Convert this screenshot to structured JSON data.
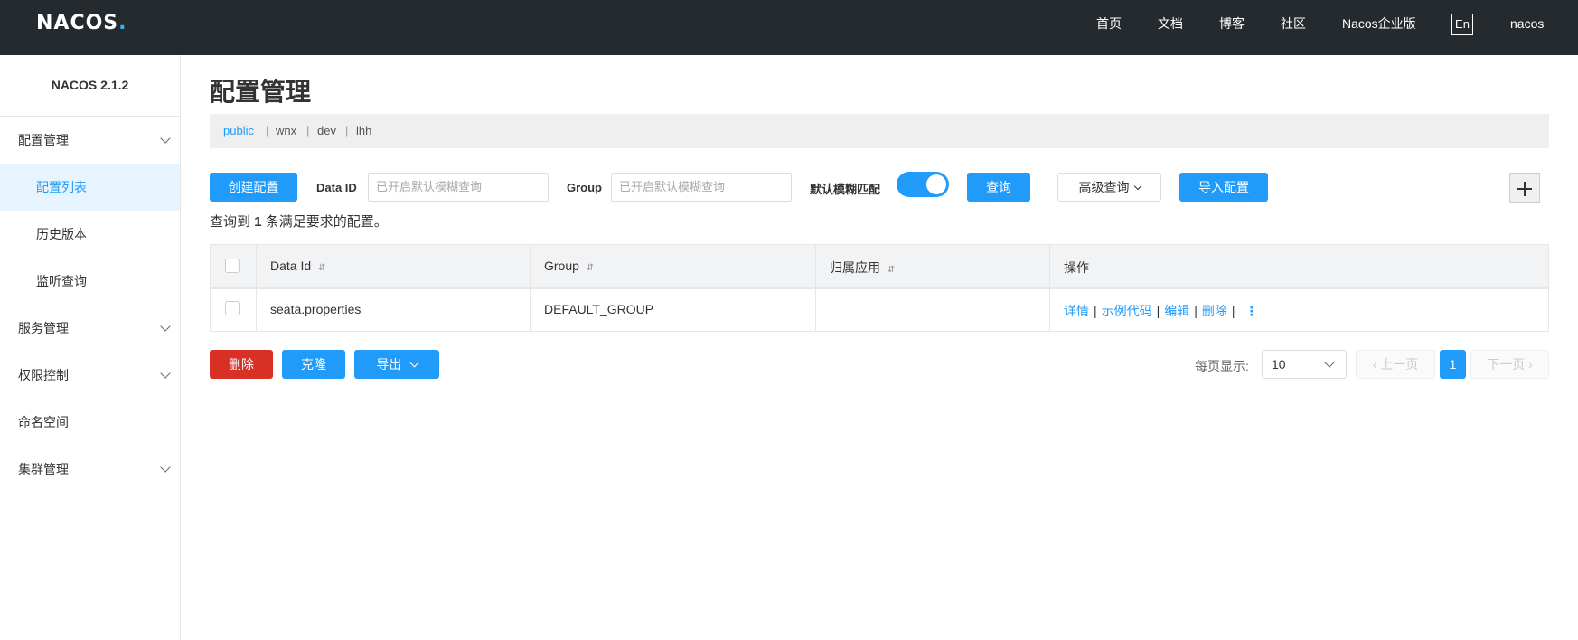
{
  "topbar": {
    "logo": "NACOS",
    "nav": [
      "首页",
      "文档",
      "博客",
      "社区",
      "Nacos企业版"
    ],
    "lang": "En",
    "user": "nacos"
  },
  "sidebar": {
    "version": "NACOS 2.1.2",
    "items": [
      {
        "label": "配置管理"
      },
      {
        "label": "配置列表"
      },
      {
        "label": "历史版本"
      },
      {
        "label": "监听查询"
      },
      {
        "label": "服务管理"
      },
      {
        "label": "权限控制"
      },
      {
        "label": "命名空间"
      },
      {
        "label": "集群管理"
      }
    ]
  },
  "main": {
    "title": "配置管理",
    "namespaces": [
      "public",
      "wnx",
      "dev",
      "lhh"
    ],
    "toolbar": {
      "create": "创建配置",
      "dataid_label": "Data ID",
      "dataid_placeholder": "已开启默认模糊查询",
      "group_label": "Group",
      "group_placeholder": "已开启默认模糊查询",
      "fuzzy_label": "默认模糊匹配",
      "query": "查询",
      "advanced": "高级查询",
      "import": "导入配置"
    },
    "summary_prefix": "查询到",
    "summary_count": "1",
    "summary_suffix": "条满足要求的配置。",
    "table": {
      "headers": [
        "Data Id",
        "Group",
        "归属应用",
        "操作"
      ],
      "sort_icon": "⇵",
      "rows": [
        {
          "data_id": "seata.properties",
          "group": "DEFAULT_GROUP",
          "app": ""
        }
      ],
      "ops": [
        "详情",
        "示例代码",
        "编辑",
        "删除"
      ]
    },
    "footer": {
      "delete": "删除",
      "clone": "克隆",
      "export": "导出",
      "page_size_label": "每页显示:",
      "page_size": "10",
      "prev": "上一页",
      "page": "1",
      "next": "下一页"
    }
  }
}
